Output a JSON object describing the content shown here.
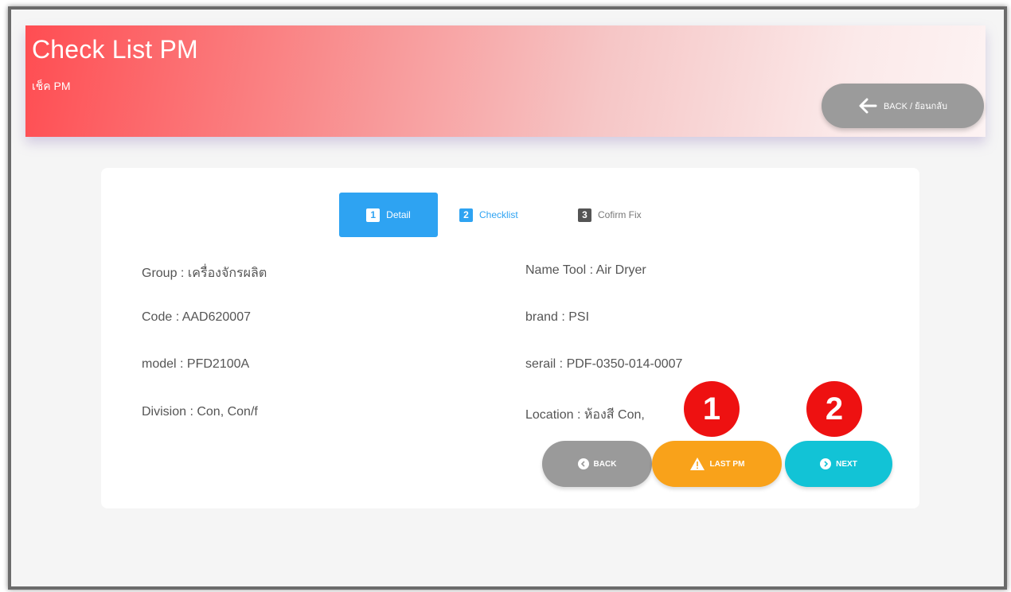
{
  "header": {
    "title": "Check List PM",
    "subtitle": "เช็ค PM",
    "back_label": "BACK / ย้อนกลับ"
  },
  "steps": [
    {
      "number": "1",
      "label": "Detail",
      "active": true
    },
    {
      "number": "2",
      "label": "Checklist",
      "active": false
    },
    {
      "number": "3",
      "label": "Cofirm Fix",
      "active": false
    }
  ],
  "details": {
    "group": "Group : เครื่องจักรผลิต",
    "code": "Code : AAD620007",
    "model": "model : PFD2100A",
    "division": "Division : Con, Con/f",
    "name_tool": "Name Tool : Air Dryer",
    "brand": "brand : PSI",
    "serial": "serail : PDF-0350-014-0007",
    "location": "Location : ห้องสี Con,"
  },
  "badges": [
    "1",
    "2"
  ],
  "actions": {
    "back_label": "BACK",
    "last_pm_label": "LAST PM",
    "next_label": "NEXT"
  },
  "colors": {
    "header_start": "#ff4d52",
    "step_active": "#2ea3f2",
    "back_button": "#9a9a9a",
    "last_pm_button": "#f9a21a",
    "next_button": "#12c3d6",
    "badge": "#ee1111"
  }
}
